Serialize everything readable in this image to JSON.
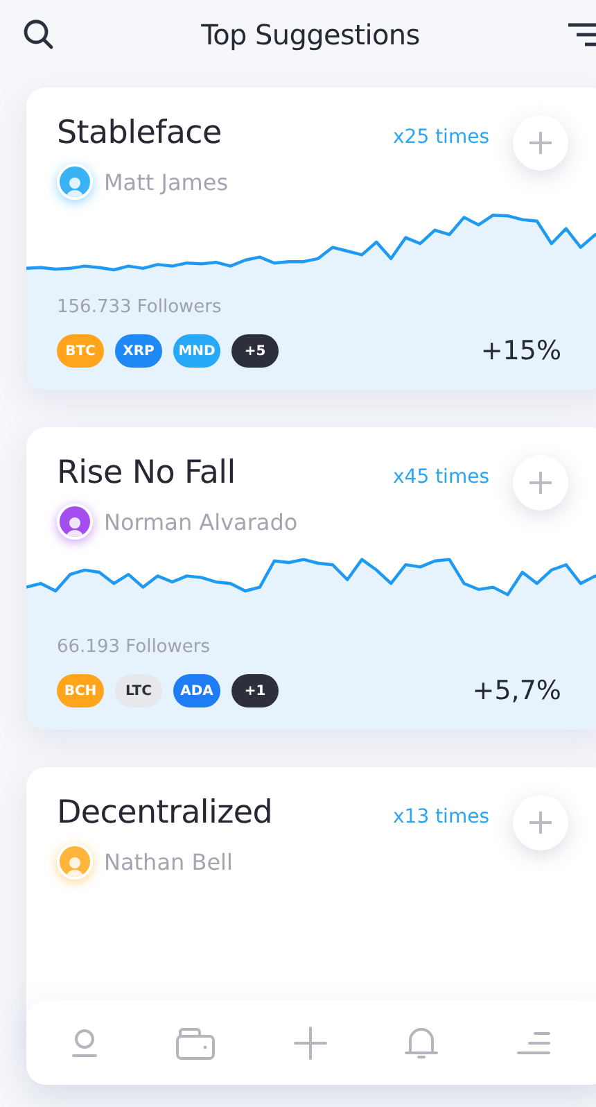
{
  "header": {
    "title": "Top Suggestions"
  },
  "cards": [
    {
      "title": "Stableface",
      "times": "x25 times",
      "author": "Matt James",
      "color": "#3ab3f5",
      "followers": "156.733 Followers",
      "change": "+15%",
      "tags": [
        {
          "label": "BTC",
          "color": "#ffa41b"
        },
        {
          "label": "XRP",
          "color": "#1e88f5"
        },
        {
          "label": "MND",
          "color": "#27a9f7"
        },
        {
          "label": "+5",
          "color": "#2d2f3c"
        }
      ]
    },
    {
      "title": "Rise No Fall",
      "times": "x45 times",
      "author": "Norman Alvarado",
      "color": "#a44ef0",
      "followers": "66.193 Followers",
      "change": "+5,7%",
      "tags": [
        {
          "label": "BCH",
          "color": "#ffa41b"
        },
        {
          "label": "LTC",
          "color": "#e6e8ec"
        },
        {
          "label": "ADA",
          "color": "#1e7cf5"
        },
        {
          "label": "+1",
          "color": "#2d2f3c"
        }
      ]
    },
    {
      "title": "Decentralized",
      "times": "x13 times",
      "author": "Nathan Bell",
      "color": "#ffb43a"
    }
  ],
  "nav": [
    {
      "kind": "profile"
    },
    {
      "kind": "wallet"
    },
    {
      "kind": "add"
    },
    {
      "kind": "notifications"
    },
    {
      "kind": "menu"
    }
  ]
}
